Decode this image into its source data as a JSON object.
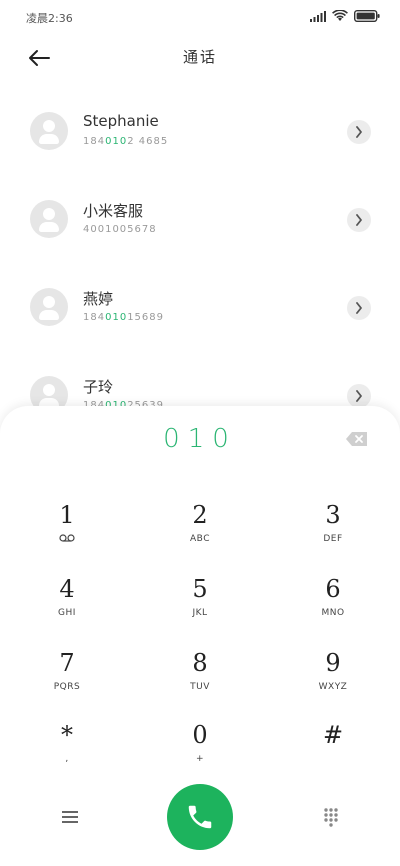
{
  "status": {
    "time": "凌晨2:36",
    "icons": [
      "signal-icon",
      "wifi-icon",
      "battery-icon"
    ]
  },
  "header": {
    "title": "通话",
    "back_icon": "back-arrow-icon"
  },
  "contacts": [
    {
      "name": "Stephanie",
      "number_prefix": "184",
      "number_match": "010",
      "number_suffix": "2 4685"
    },
    {
      "name": "小米客服",
      "number_prefix": "4001005678",
      "number_match": "",
      "number_suffix": ""
    },
    {
      "name": "燕婷",
      "number_prefix": "184",
      "number_match": "010",
      "number_suffix": "15689"
    },
    {
      "name": "子玲",
      "number_prefix": "184",
      "number_match": "010",
      "number_suffix": "25639"
    }
  ],
  "dialpad": {
    "input_value": "010",
    "keys": [
      {
        "digit": "1",
        "letters": ""
      },
      {
        "digit": "2",
        "letters": "ABC"
      },
      {
        "digit": "3",
        "letters": "DEF"
      },
      {
        "digit": "4",
        "letters": "GHI"
      },
      {
        "digit": "5",
        "letters": "JKL"
      },
      {
        "digit": "6",
        "letters": "MNO"
      },
      {
        "digit": "7",
        "letters": "PQRS"
      },
      {
        "digit": "8",
        "letters": "TUV"
      },
      {
        "digit": "9",
        "letters": "WXYZ"
      },
      {
        "digit": "*",
        "letters": ","
      },
      {
        "digit": "0",
        "letters": "+"
      },
      {
        "digit": "#",
        "letters": ""
      }
    ]
  },
  "colors": {
    "accent": "#2bb573",
    "call": "#1db35d"
  }
}
